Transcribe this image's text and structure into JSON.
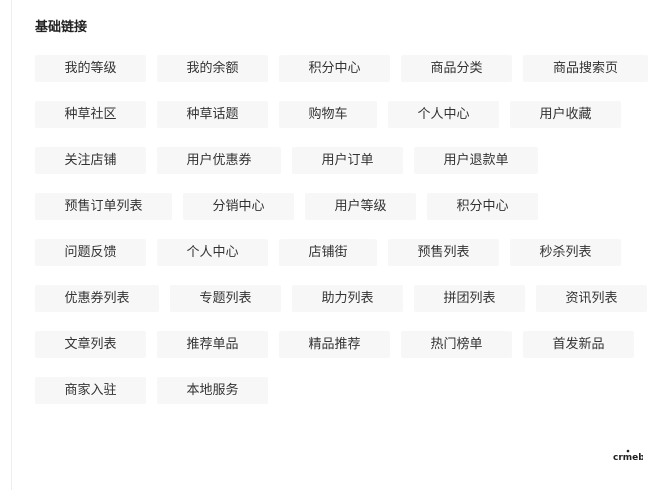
{
  "section": {
    "title": "基础链接"
  },
  "links": {
    "my_level": "我的等级",
    "my_balance": "我的余额",
    "points_center": "积分中心",
    "product_category": "商品分类",
    "product_search": "商品搜索页",
    "grass_community": "种草社区",
    "grass_topic": "种草话题",
    "cart": "购物车",
    "personal_center": "个人中心",
    "user_favorites": "用户收藏",
    "followed_shops": "关注店铺",
    "user_coupons": "用户优惠券",
    "user_orders": "用户订单",
    "user_refund_orders": "用户退款单",
    "presale_order_list": "预售订单列表",
    "distribution_center": "分销中心",
    "user_level": "用户等级",
    "points_center_2": "积分中心",
    "faq_feedback": "问题反馈",
    "personal_center_2": "个人中心",
    "shop_street": "店铺街",
    "presale_list": "预售列表",
    "flash_sale_list": "秒杀列表",
    "coupon_list": "优惠券列表",
    "topic_list": "专题列表",
    "assist_list": "助力列表",
    "group_buy_list": "拼团列表",
    "news_list": "资讯列表",
    "article_list": "文章列表",
    "recommended_items": "推荐单品",
    "featured_recommend": "精品推荐",
    "hot_ranking": "热门榜单",
    "new_launch": "首发新品",
    "merchant_join": "商家入驻",
    "local_service": "本地服务"
  },
  "brand": {
    "logo_icon": "crmeb-logo-icon"
  }
}
